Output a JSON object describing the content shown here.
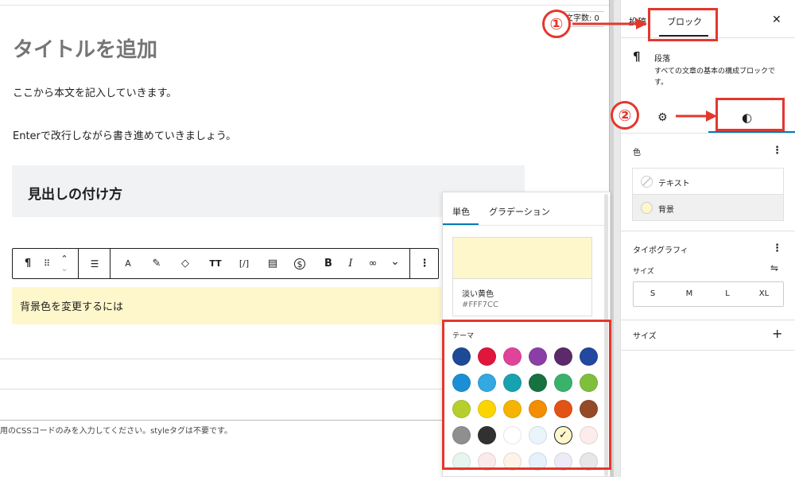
{
  "editor": {
    "word_count": "文字数: 0",
    "title_placeholder": "タイトルを追加",
    "paragraph1": "ここから本文を記入していきます。",
    "paragraph2": "Enterで改行しながら書き進めていきましょう。",
    "heading": "見出しの付け方",
    "bg_paragraph": "背景色を変更するには",
    "css_note": "用のCSSコードのみを入力してください。styleタグは不要です。"
  },
  "toolbar": {
    "items": [
      {
        "name": "paragraph-icon",
        "glyph": "¶"
      },
      {
        "name": "drag-handle-icon",
        "glyph": "⠿"
      },
      {
        "name": "move-up-down-icon",
        "glyph": "⌃"
      },
      {
        "name": "align-icon",
        "glyph": "☰"
      },
      {
        "name": "font-icon",
        "glyph": "A"
      },
      {
        "name": "highlight-icon",
        "glyph": "✎"
      },
      {
        "name": "tag-icon",
        "glyph": "◇"
      },
      {
        "name": "text-size-icon",
        "glyph": "TT"
      },
      {
        "name": "inline-code-icon",
        "glyph": "[/]"
      },
      {
        "name": "document-icon",
        "glyph": "▤"
      },
      {
        "name": "currency-icon",
        "glyph": "$"
      },
      {
        "name": "bold-icon",
        "glyph": "B"
      },
      {
        "name": "italic-icon",
        "glyph": "I"
      },
      {
        "name": "link-icon",
        "glyph": "∞"
      },
      {
        "name": "more-chevron-icon",
        "glyph": "⌄"
      },
      {
        "name": "options-icon",
        "glyph": "⋮"
      }
    ]
  },
  "color_popover": {
    "tab_solid": "単色",
    "tab_gradient": "グラデーション",
    "selected_name": "淡い黄色",
    "selected_hex": "#FFF7CC",
    "theme_label": "テーマ",
    "swatches": [
      "#1d4a96",
      "#e0163d",
      "#e0449a",
      "#8b3fa6",
      "#5c2a6b",
      "#2348a0",
      "#1a8fd6",
      "#34a8e0",
      "#17a2b0",
      "#16723f",
      "#3ab26b",
      "#7fbf3d",
      "#b7cf2c",
      "#fbd500",
      "#f6b400",
      "#f28e00",
      "#e35316",
      "#944a26",
      "#8f8f8f",
      "#313131",
      "#ffffff",
      "#eaf4fb",
      "#fff7cc",
      "#fdecec",
      "#e6f5ee",
      "#fbeaea",
      "#fdf3e6",
      "#e6f1fb",
      "#ecebf7",
      "#e7e7e7"
    ],
    "selected_index": 22
  },
  "sidebar": {
    "tab_post": "投稿",
    "tab_block": "ブロック",
    "block_name": "段落",
    "block_desc": "すべての文章の基本の構成ブロックです。",
    "color_label": "色",
    "text_label": "テキスト",
    "bg_label": "背景",
    "bg_color": "#fff7cc",
    "typography_label": "タイポグラフィ",
    "size_label": "サイズ",
    "sizes": [
      "S",
      "M",
      "L",
      "XL"
    ],
    "size2_label": "サイズ"
  },
  "annotations": {
    "step1": "①",
    "step2": "②",
    "accent_color": "#e4372d"
  }
}
